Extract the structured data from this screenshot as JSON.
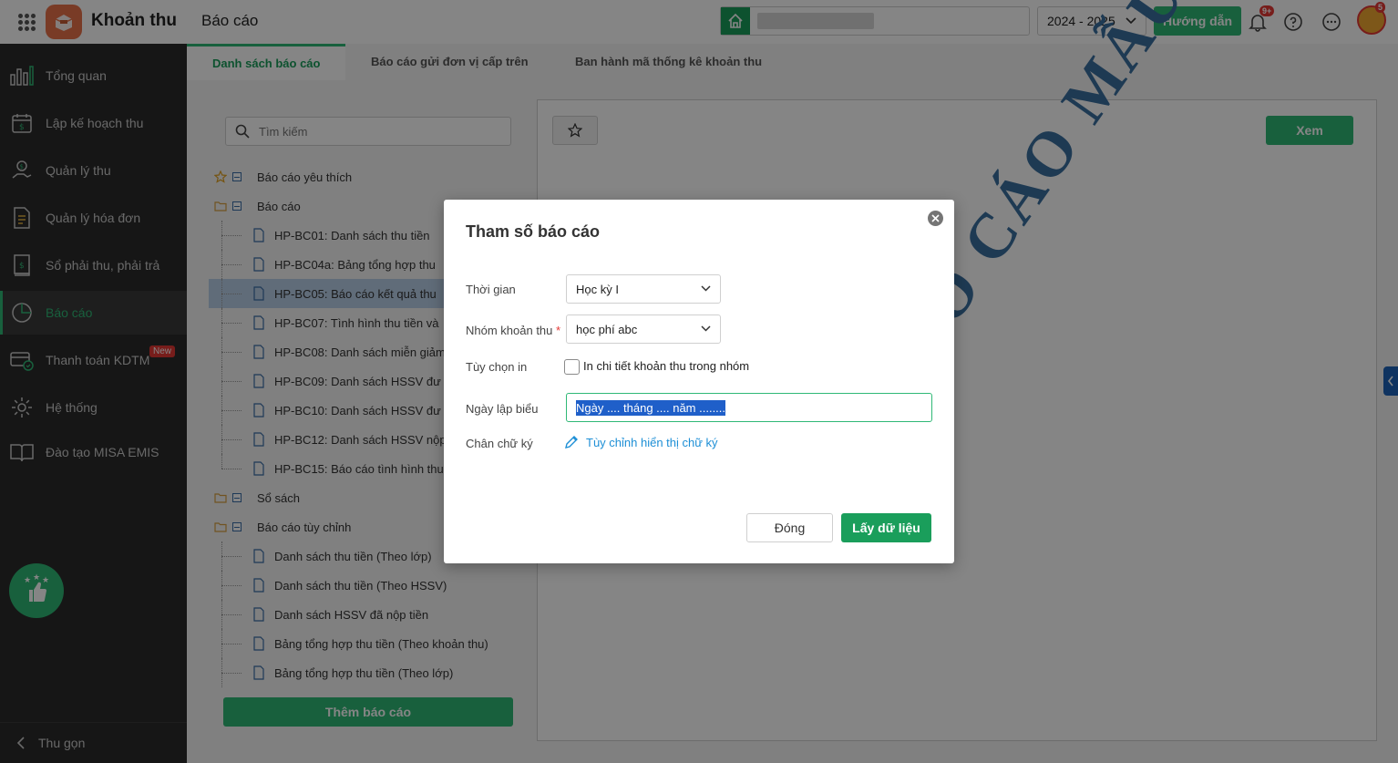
{
  "header": {
    "app_title": "Khoản thu",
    "page_title": "Báo cáo",
    "school_year": "2024 - 2025",
    "guide_label": "Hướng dẫn",
    "notification_badge": "9+",
    "avatar_badge": "5"
  },
  "sidebar": {
    "items": [
      {
        "label": "Tổng quan",
        "icon": "bar-chart-icon"
      },
      {
        "label": "Lập kế hoạch thu",
        "icon": "calendar-money-icon"
      },
      {
        "label": "Quản lý thu",
        "icon": "hand-coin-icon"
      },
      {
        "label": "Quản lý hóa đơn",
        "icon": "invoice-icon"
      },
      {
        "label": "Sổ phải thu, phải trả",
        "icon": "ledger-icon"
      },
      {
        "label": "Báo cáo",
        "icon": "pie-chart-icon"
      },
      {
        "label": "Thanh toán KDTM",
        "icon": "payment-icon",
        "badge": "New"
      },
      {
        "label": "Hệ thống",
        "icon": "gear-icon"
      },
      {
        "label": "Đào tạo MISA EMIS",
        "icon": "book-icon"
      }
    ],
    "active_index": 5,
    "collapse_label": "Thu gọn"
  },
  "tabs": [
    "Danh sách báo cáo",
    "Báo cáo gửi đơn vị cấp trên",
    "Ban hành mã thống kê khoản thu"
  ],
  "search": {
    "placeholder": "Tìm kiếm"
  },
  "tree": {
    "favorites": "Báo cáo yêu thích",
    "reports_group": "Báo cáo",
    "reports": [
      "HP-BC01: Danh sách thu tiền",
      "HP-BC04a: Bảng tổng hợp thu",
      "HP-BC05: Báo cáo kết quả thu",
      "HP-BC07: Tình hình thu tiền và",
      "HP-BC08: Danh sách miễn giảm",
      "HP-BC09: Danh sách HSSV đư",
      "HP-BC10: Danh sách HSSV đư",
      "HP-BC12: Danh sách HSSV nộp",
      "HP-BC15: Báo cáo tình hình thu"
    ],
    "selected_report": 2,
    "books_group": "Sổ sách",
    "custom_group": "Báo cáo tùy chỉnh",
    "custom_reports": [
      "Danh sách thu tiền (Theo lớp)",
      "Danh sách thu tiền (Theo HSSV)",
      "Danh sách HSSV đã nộp tiền",
      "Bảng tổng hợp thu tiền (Theo khoản thu)",
      "Bảng tổng hợp thu tiền (Theo lớp)"
    ]
  },
  "add_report_label": "Thêm báo cáo",
  "preview": {
    "view_label": "Xem",
    "watermark": "BÁO CÁO MẪU"
  },
  "modal": {
    "title": "Tham số báo cáo",
    "time_label": "Thời gian",
    "time_value": "Học kỳ I",
    "group_label": "Nhóm khoản thu",
    "required_mark": "*",
    "group_value": "học phí abc",
    "print_option_label": "Tùy chọn in",
    "print_option_checkbox": "In chi tiết khoản thu trong nhóm",
    "print_option_checked": false,
    "date_label": "Ngày lập biểu",
    "date_value": "Ngày .... tháng .... năm ........",
    "signature_label": "Chân chữ ký",
    "signature_link": "Tùy chỉnh hiển thị chữ ký",
    "close_label": "Đóng",
    "fetch_label": "Lấy dữ liệu"
  },
  "colors": {
    "brand_green": "#2fb876",
    "sidebar_bg": "#2b2b2b",
    "link_blue": "#1d8fd6",
    "selection_blue": "#1f5fc9"
  }
}
